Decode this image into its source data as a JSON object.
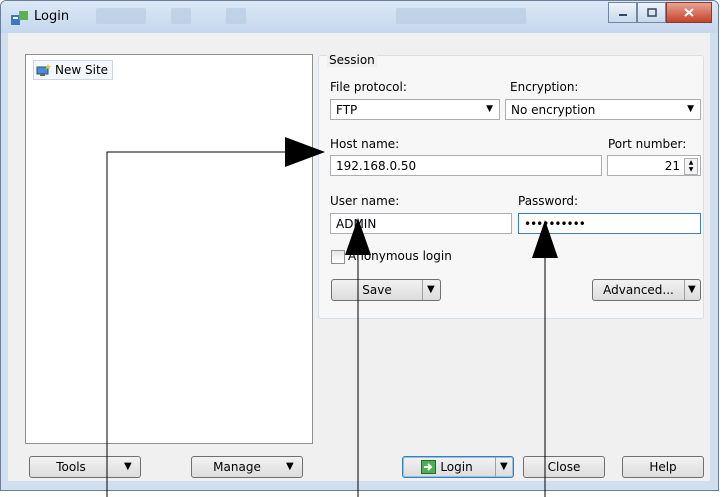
{
  "window": {
    "title": "Login"
  },
  "sites": {
    "items": [
      {
        "label": "New Site"
      }
    ]
  },
  "session": {
    "group_label": "Session",
    "file_protocol": {
      "label": "File protocol:",
      "value": "FTP"
    },
    "encryption": {
      "label": "Encryption:",
      "value": "No encryption"
    },
    "host": {
      "label": "Host name:",
      "value": "192.168.0.50"
    },
    "port": {
      "label": "Port number:",
      "value": "21"
    },
    "username": {
      "label": "User name:",
      "value": "ADMIN"
    },
    "password": {
      "label": "Password:",
      "value": "••••••••••"
    },
    "anonymous": {
      "label": "Anonymous login",
      "checked": false
    },
    "save_label": "Save",
    "advanced_label": "Advanced..."
  },
  "footer": {
    "tools_label": "Tools",
    "manage_label": "Manage",
    "login_label": "Login",
    "close_label": "Close",
    "help_label": "Help"
  }
}
